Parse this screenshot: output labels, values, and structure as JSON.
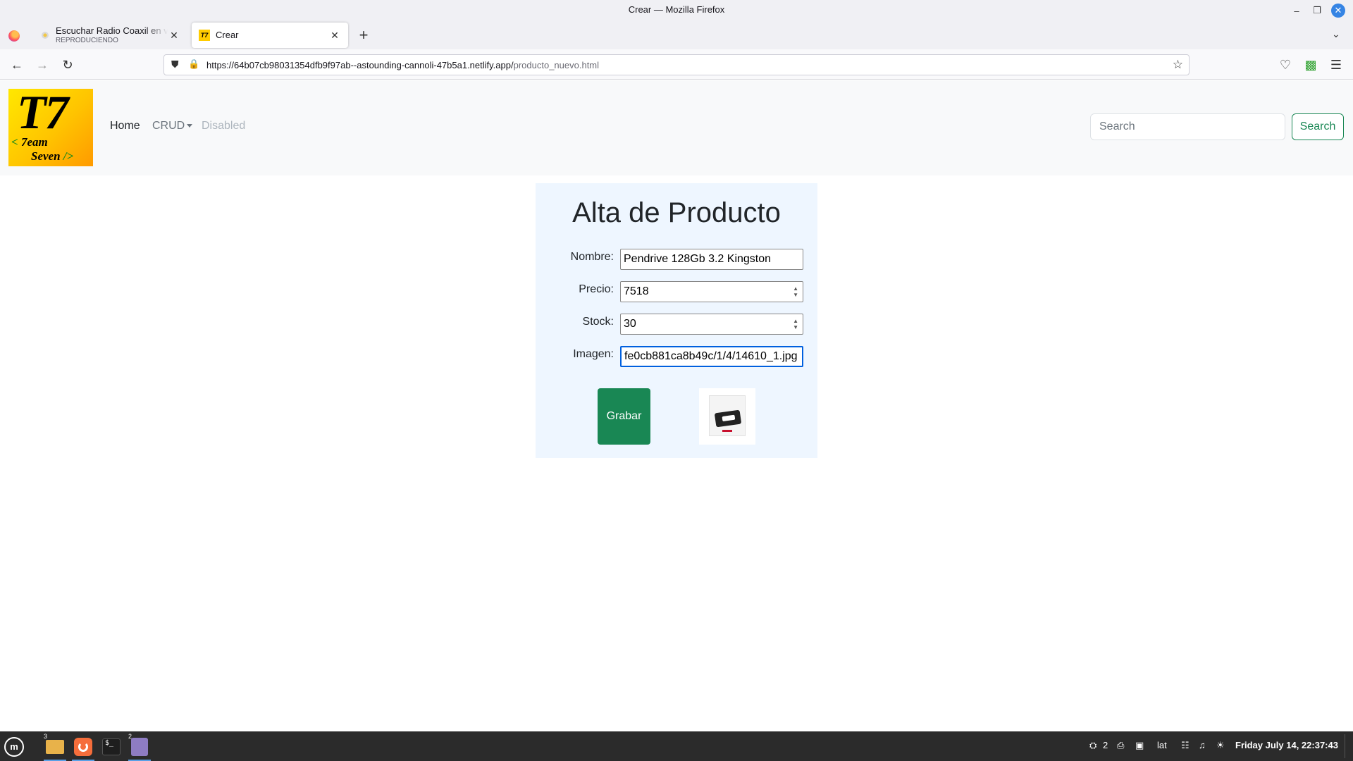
{
  "window": {
    "title": "Crear — Mozilla Firefox"
  },
  "tabs": [
    {
      "title": "Escuchar Radio Coaxil en vivo",
      "subtitle": "REPRODUCIENDO"
    },
    {
      "title": "Crear"
    }
  ],
  "urlbar": {
    "host": "https://64b07cb98031354dfb9f97ab--astounding-cannoli-47b5a1.netlify.app/",
    "path": "producto_nuevo.html"
  },
  "site": {
    "logo": {
      "big": "T7",
      "line1": "7eam",
      "line2": "Seven"
    },
    "nav": {
      "home": "Home",
      "crud": "CRUD",
      "disabled": "Disabled"
    },
    "search": {
      "placeholder": "Search",
      "button": "Search"
    }
  },
  "form": {
    "title": "Alta de Producto",
    "fields": {
      "nombre": {
        "label": "Nombre:",
        "value": "Pendrive 128Gb 3.2 Kingston"
      },
      "precio": {
        "label": "Precio:",
        "value": "7518"
      },
      "stock": {
        "label": "Stock:",
        "value": "30"
      },
      "imagen": {
        "label": "Imagen:",
        "value": "fe0cb881ca8b49c/1/4/14610_1.jpg"
      }
    },
    "submit": "Grabar"
  },
  "taskbar": {
    "files_badge": "3",
    "notes_badge": "2",
    "tray": {
      "updates": "2",
      "keyboard": "lat",
      "clock": "Friday July 14, 22:37:43"
    }
  },
  "colors": {
    "accent": "#198754",
    "focus": "#0060df",
    "card_bg": "#eef6ff",
    "navbar_bg": "#f8f9fa"
  }
}
